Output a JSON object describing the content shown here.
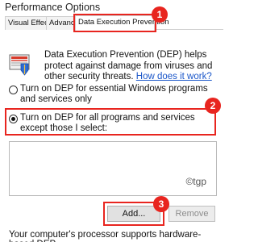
{
  "window": {
    "title": "Performance Options"
  },
  "tabs": [
    {
      "label": "Visual Effects"
    },
    {
      "label": "Advanced"
    },
    {
      "label": "Data Execution Prevention"
    }
  ],
  "dep": {
    "description": "Data Execution Prevention (DEP) helps protect against damage from viruses and other security threats.",
    "link": "How does it work?"
  },
  "options": [
    {
      "label": "Turn on DEP for essential Windows programs and services only",
      "selected": false
    },
    {
      "label": "Turn on DEP for all programs and services except those I select:",
      "selected": true
    }
  ],
  "program_list": {
    "items": [],
    "watermark": "©tgp"
  },
  "buttons": {
    "add": "Add...",
    "remove": "Remove"
  },
  "status": "Your computer's processor supports hardware-based DEP.",
  "annotations": {
    "step1": "1",
    "step2": "2",
    "step3": "3",
    "color": "#e8251f"
  }
}
